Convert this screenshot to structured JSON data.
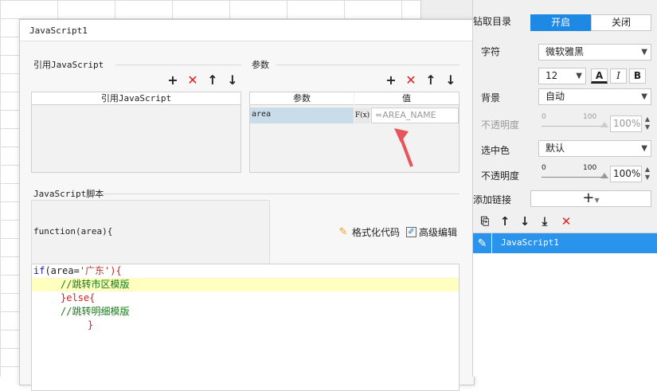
{
  "dialog": {
    "title": "JavaScript1",
    "ref_section": {
      "label": "引用JavaScript",
      "column": "引用JavaScript"
    },
    "param_section": {
      "label": "参数",
      "columns": [
        "参数",
        "值"
      ],
      "row": {
        "name": "area",
        "fx": "F(x)",
        "value_placeholder": "=AREA_NAME"
      }
    },
    "script_section": {
      "label": "JavaScript脚本",
      "signature": "function(area){",
      "format_label": "格式化代码",
      "advanced_label": "高级编辑",
      "code_lines": [
        {
          "kw": "if",
          "a": "(area=",
          "str": "'广东'",
          "b": "){"
        },
        {
          "comment": "//跳转市区模版"
        },
        {
          "text": "}else{"
        },
        {
          "comment": "//跳转明细模版"
        },
        {
          "text": "}"
        }
      ]
    },
    "toolbar_icons": [
      "plus-icon",
      "delete-icon",
      "arrow-up-icon",
      "arrow-down-icon"
    ]
  },
  "right_panel": {
    "drill_label": "钻取目录",
    "drill_on": "开启",
    "drill_off": "关闭",
    "font_label": "字符",
    "font_value": "微软雅黑",
    "font_size": "12",
    "fmt_buttons": [
      "A",
      "I",
      "B"
    ],
    "bg_label": "背景",
    "bg_value": "自动",
    "opacity_label": "不透明度",
    "slider_min": "0",
    "slider_max": "100",
    "opacity_value": "100%",
    "sel_color_label": "选中色",
    "sel_color_value": "默认",
    "opacity2_label": "不透明度",
    "opacity2_value": "100%",
    "add_link_label": "添加链接",
    "add_link_btn": "+",
    "link_item": "JavaScript1"
  },
  "colors": {
    "accent": "#1e88e5",
    "selected_row": "#2a93ec",
    "delete": "#e02020",
    "highlight_line": "#ffffc0"
  }
}
